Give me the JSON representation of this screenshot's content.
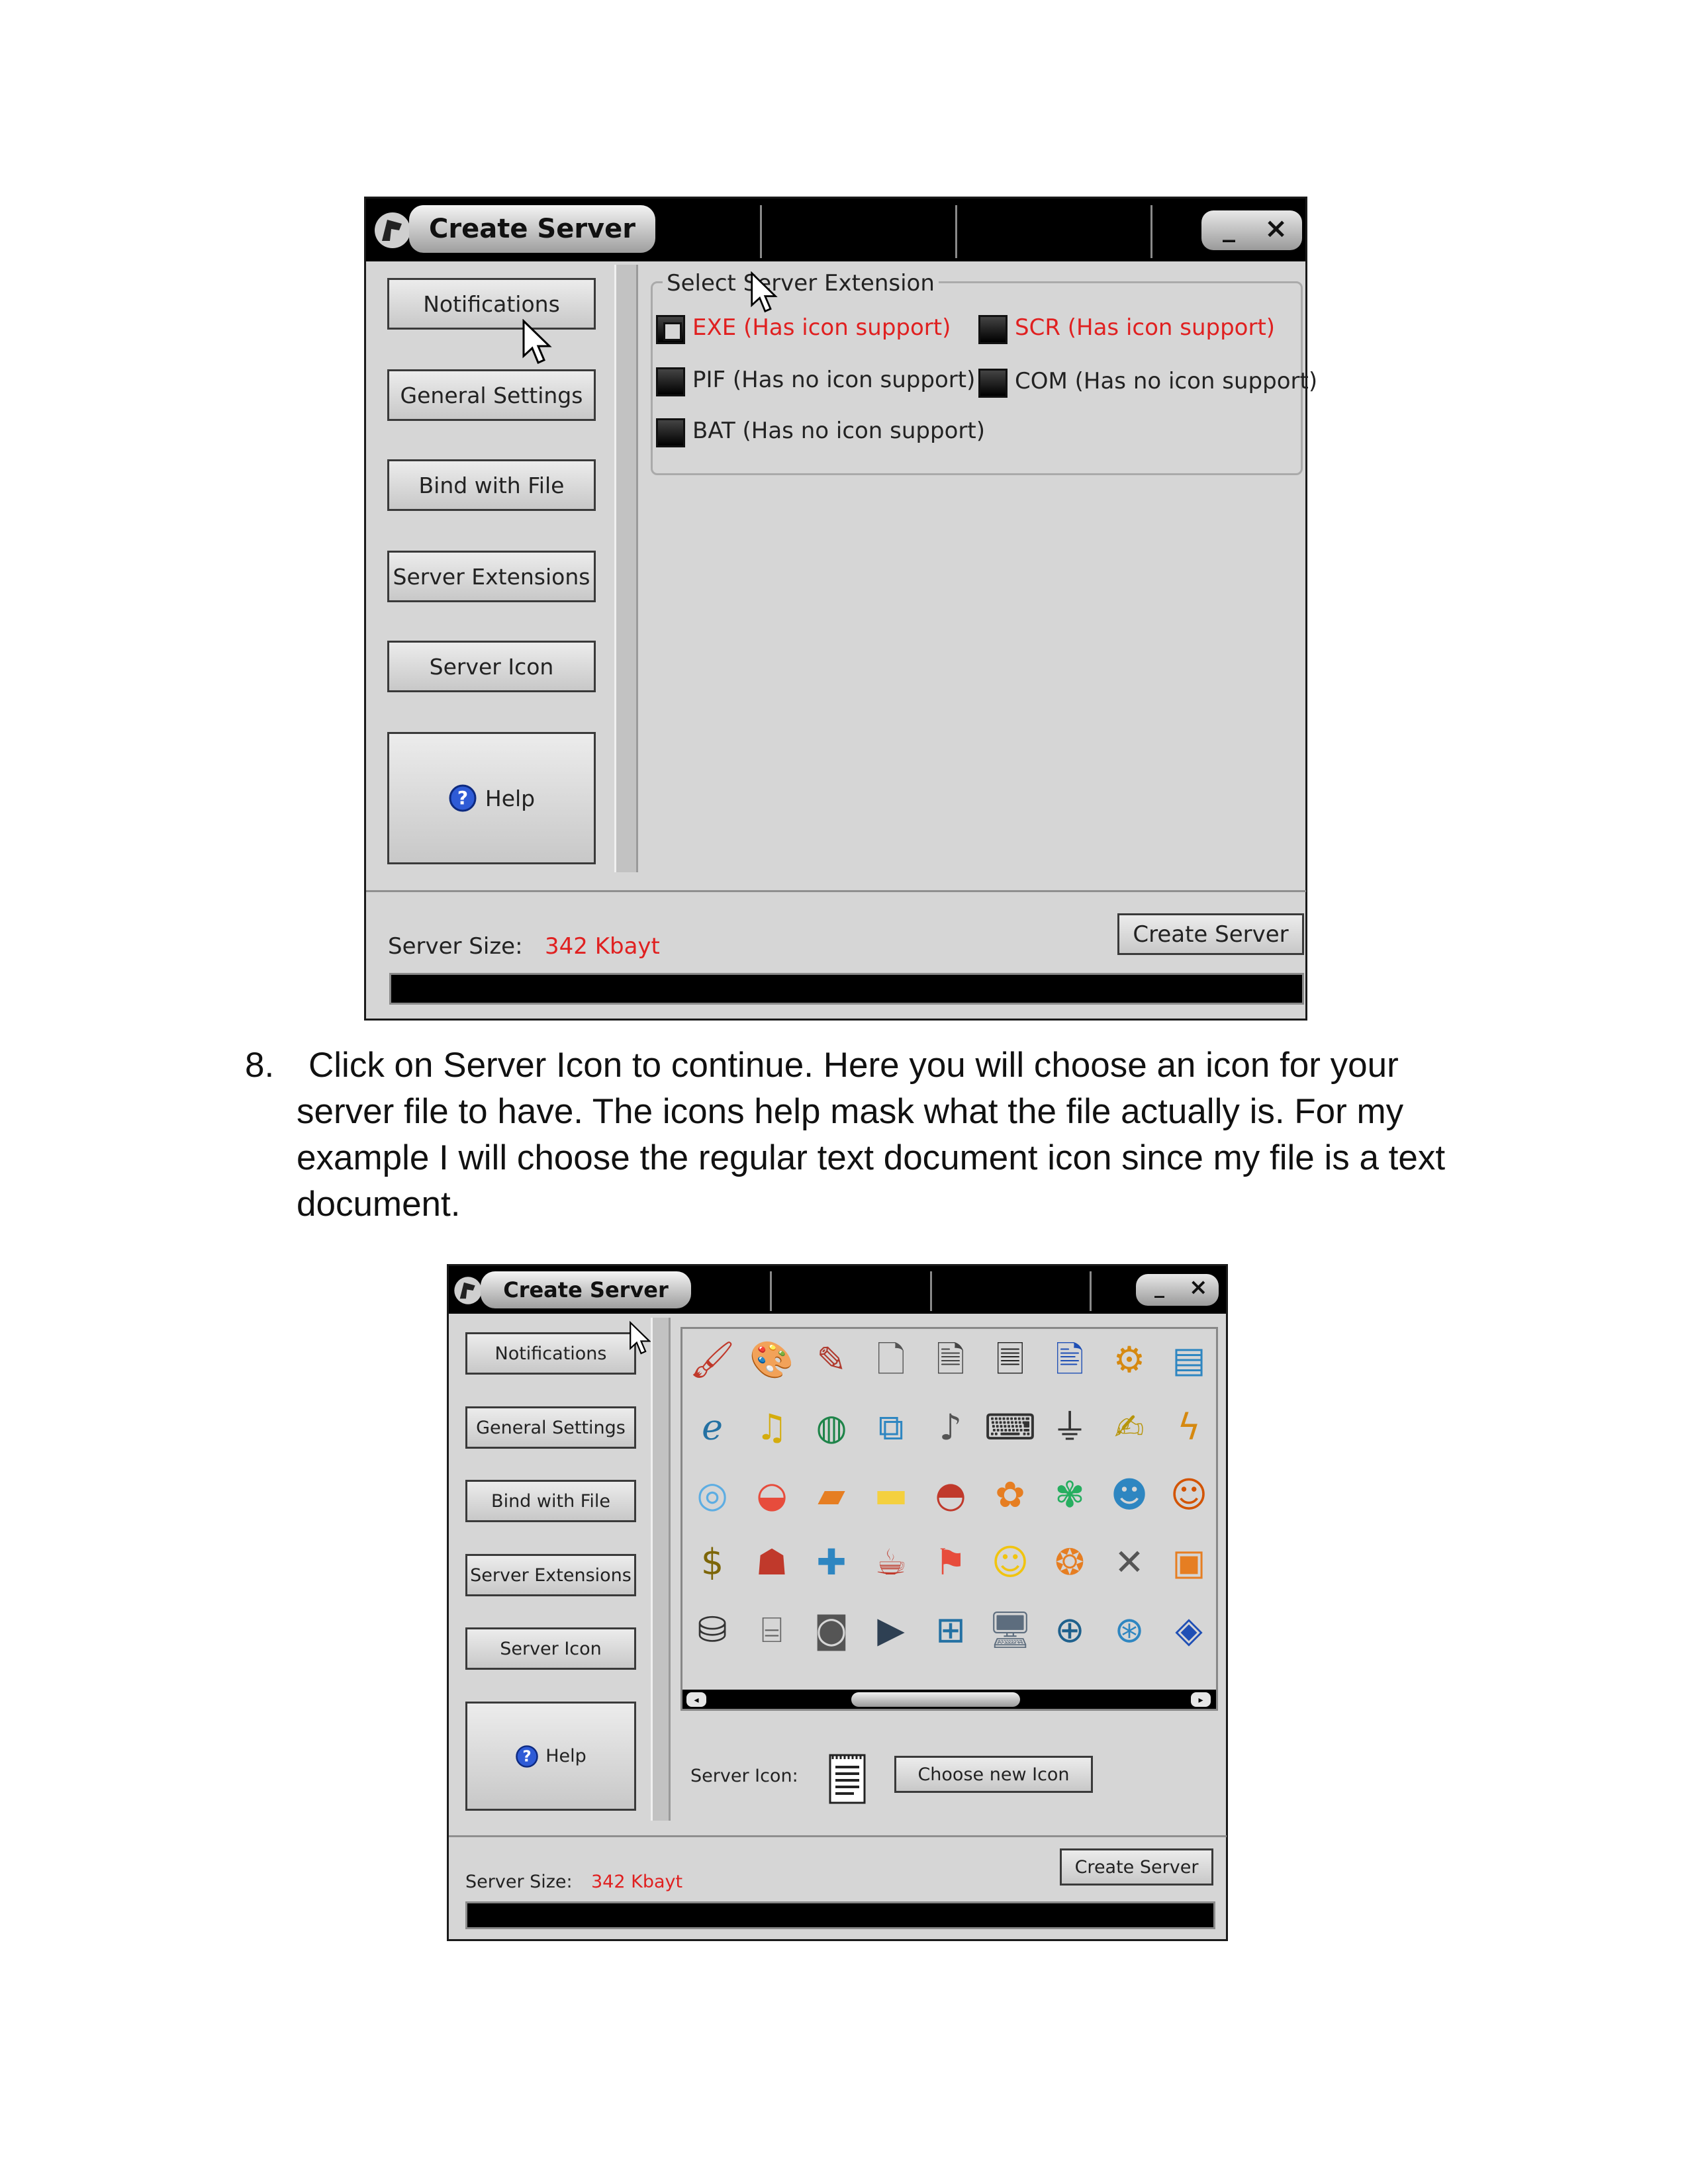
{
  "window1": {
    "title": "Create Server",
    "minimize": "_",
    "close": "×",
    "nav": [
      "Notifications",
      "General Settings",
      "Bind with File",
      "Server Extensions",
      "Server Icon"
    ],
    "help": "Help",
    "group_title": "Select Server Extension",
    "options": [
      {
        "label": "EXE (Has icon support)",
        "checked": true,
        "color": "#e02020"
      },
      {
        "label": "SCR (Has icon support)",
        "checked": false,
        "color": "#e02020"
      },
      {
        "label": "PIF (Has no icon support)",
        "checked": false,
        "color": "#222222"
      },
      {
        "label": "COM (Has no icon support)",
        "checked": false,
        "color": "#222222"
      },
      {
        "label": "BAT (Has no icon support)",
        "checked": false,
        "color": "#222222"
      }
    ],
    "server_size_label": "Server Size:",
    "server_size_value": "342 Kbayt",
    "create_button": "Create Server"
  },
  "instruction": {
    "number": "8.",
    "text": "Click on Server Icon to continue. Here you will choose an icon for your server file to have. The icons help mask what the file actually is. For my example I will choose the regular text document icon since my file is a text document."
  },
  "window2": {
    "title": "Create Server",
    "minimize": "_",
    "close": "×",
    "nav": [
      "Notifications",
      "General Settings",
      "Bind with File",
      "Server Extensions",
      "Server Icon"
    ],
    "help": "Help",
    "server_icon_label": "Server Icon:",
    "choose_button": "Choose new Icon",
    "server_size_label": "Server Size:",
    "server_size_value": "342 Kbayt",
    "create_button": "Create Server",
    "icon_rows": [
      [
        "paint-brushes-icon",
        "painter-icon",
        "notepad-pencil-icon",
        "blank-document-icon",
        "text-document-lines-icon",
        "text-document-icon",
        "word-document-icon",
        "document-gear-icon",
        "notepad-icon"
      ],
      [
        "internet-explorer-icon",
        "music-globe-icon",
        "globe-icon",
        "network-icon",
        "audio-file-icon",
        "document-keyboard-icon",
        "document-plug-icon",
        "document-pen-icon",
        "lightning-icon"
      ],
      [
        "cd-folder-icon",
        "lips-folder-icon",
        "car-folder-icon",
        "folder-icon",
        "lips-icon",
        "flower-folder-icon",
        "icq-flower-icon",
        "msn-users-icon",
        "users-icon"
      ],
      [
        "money-bag-icon",
        "mario-icon",
        "puzzle-icon",
        "java-icon",
        "gift-icon",
        "smiley-icon",
        "garfield-icon",
        "cat-icon",
        "mac-finder-icon"
      ],
      [
        "hard-disk-icon",
        "camera-icon",
        "camcorder-icon",
        "media-player-icon",
        "windows-monitor-icon",
        "computer-icon",
        "windows-globe-icon",
        "network-globe-icon",
        "browser-icon"
      ]
    ],
    "selected_icon": "text-document-icon"
  }
}
